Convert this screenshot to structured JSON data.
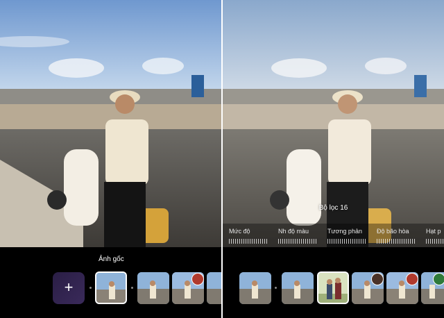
{
  "left": {
    "caption": "Ảnh gốc",
    "add_label": "+"
  },
  "right": {
    "filter_name": "Bộ lọc 16",
    "sliders": [
      {
        "label": "Mức độ"
      },
      {
        "label": "Nh độ màu"
      },
      {
        "label": "Tương phản"
      },
      {
        "label": "Độ bão hòa"
      },
      {
        "label": "Hạt p"
      }
    ]
  },
  "colors": {
    "background": "#000000",
    "sky": "#8fb3d9",
    "selected_border": "#ffffff",
    "add_button": "#2a1e45"
  }
}
